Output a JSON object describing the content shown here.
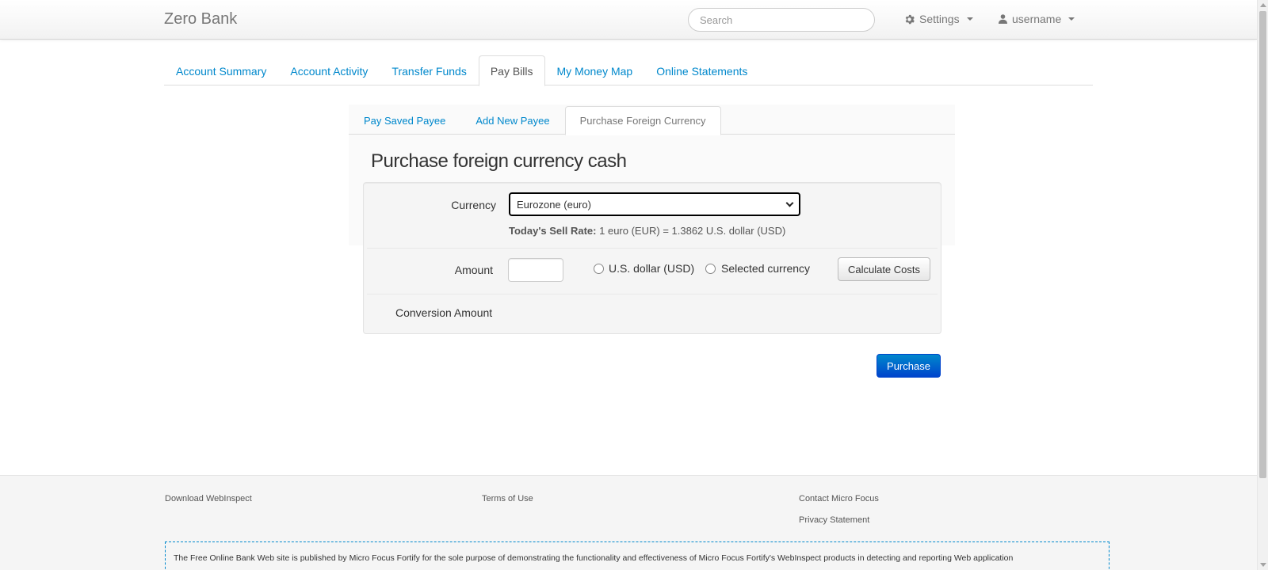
{
  "header": {
    "brand": "Zero Bank",
    "search_placeholder": "Search",
    "settings_label": "Settings",
    "user_label": "username"
  },
  "tabs": [
    {
      "label": "Account Summary"
    },
    {
      "label": "Account Activity"
    },
    {
      "label": "Transfer Funds"
    },
    {
      "label": "Pay Bills",
      "active": true
    },
    {
      "label": "My Money Map"
    },
    {
      "label": "Online Statements"
    }
  ],
  "subtabs": [
    {
      "label": "Pay Saved Payee"
    },
    {
      "label": "Add New Payee"
    },
    {
      "label": "Purchase Foreign Currency",
      "active": true
    }
  ],
  "form": {
    "title": "Purchase foreign currency cash",
    "currency_label": "Currency",
    "currency_value": "Eurozone (euro)",
    "sell_rate_label": "Today's Sell Rate:",
    "sell_rate_value": "1 euro (EUR) = 1.3862 U.S. dollar (USD)",
    "amount_label": "Amount",
    "amount_value": "",
    "radio_usd": "U.S. dollar (USD)",
    "radio_selected": "Selected currency",
    "calculate_label": "Calculate Costs",
    "conversion_label": "Conversion Amount",
    "purchase_label": "Purchase"
  },
  "footer": {
    "download": "Download WebInspect",
    "terms": "Terms of Use",
    "contact": "Contact Micro Focus",
    "privacy": "Privacy Statement",
    "disclaimer": "The Free Online Bank Web site is published by Micro Focus Fortify for the sole purpose of demonstrating the functionality and effectiveness of Micro Focus Fortify's WebInspect products in detecting and reporting Web application"
  },
  "colors": {
    "link": "#0088cc",
    "primary_button": "#0044cc"
  }
}
